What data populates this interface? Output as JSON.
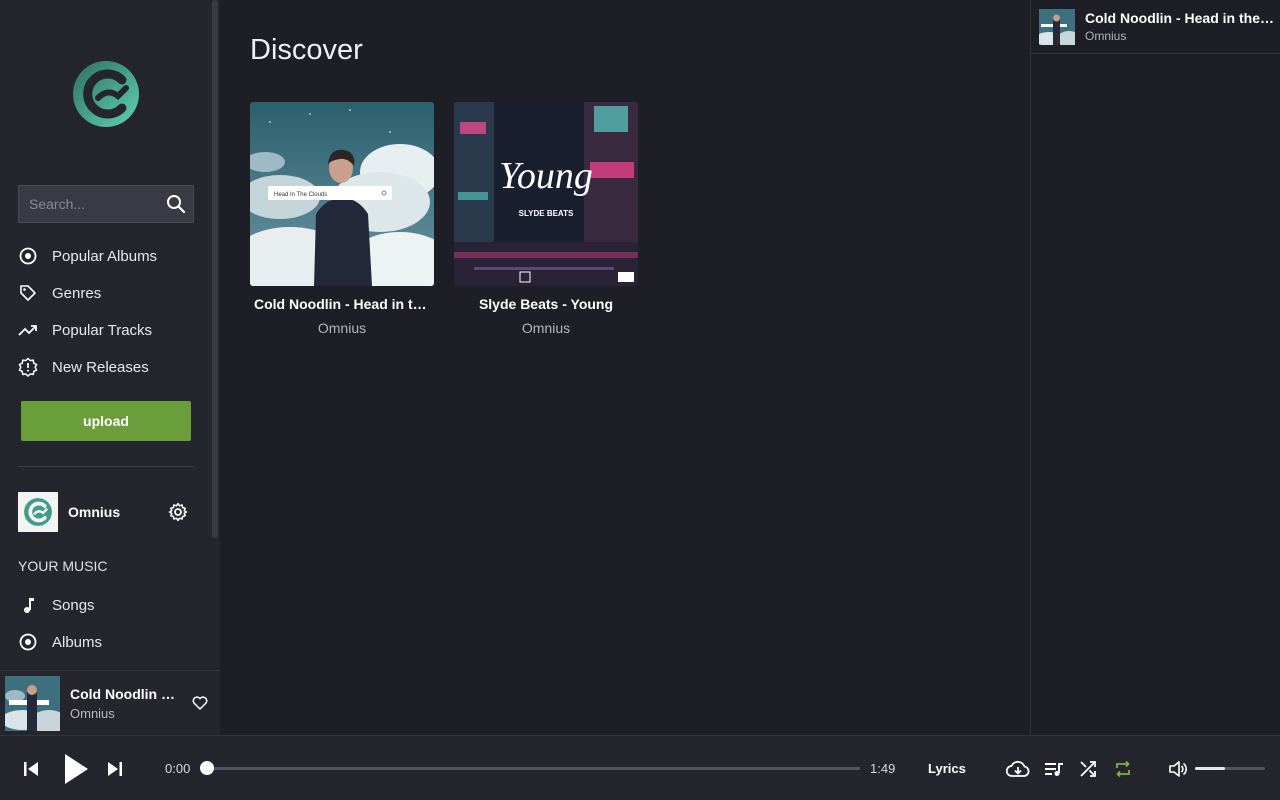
{
  "sidebar": {
    "search": {
      "placeholder": "Search..."
    },
    "nav": [
      {
        "label": "Popular Albums",
        "icon": "album-icon"
      },
      {
        "label": "Genres",
        "icon": "tag-icon"
      },
      {
        "label": "Popular Tracks",
        "icon": "trending-icon"
      },
      {
        "label": "New Releases",
        "icon": "new-releases-icon"
      }
    ],
    "upload_label": "upload",
    "user": {
      "name": "Omnius"
    },
    "your_music_title": "YOUR MUSIC",
    "your_music": [
      {
        "label": "Songs",
        "icon": "music-note-icon"
      },
      {
        "label": "Albums",
        "icon": "album-icon"
      }
    ]
  },
  "main": {
    "title": "Discover",
    "cards": [
      {
        "title": "Cold Noodlin - Head in the Clouds",
        "artist": "Omnius",
        "art_text": "Head In The Clouds"
      },
      {
        "title": "Slyde Beats - Young",
        "artist": "Omnius",
        "art_text": "Young",
        "art_sub": "SLYDE BEATS"
      }
    ]
  },
  "queue": {
    "items": [
      {
        "title": "Cold Noodlin - Head in the Clouds",
        "artist": "Omnius"
      }
    ]
  },
  "now_playing": {
    "title": "Cold Noodlin - Head in the Clouds",
    "artist": "Omnius",
    "current_time": "0:00",
    "duration": "1:49",
    "progress": 0,
    "volume": 0.43,
    "lyrics_label": "Lyrics"
  },
  "colors": {
    "accent_green": "#6a9e3a",
    "repeat_active": "#7cb342"
  }
}
